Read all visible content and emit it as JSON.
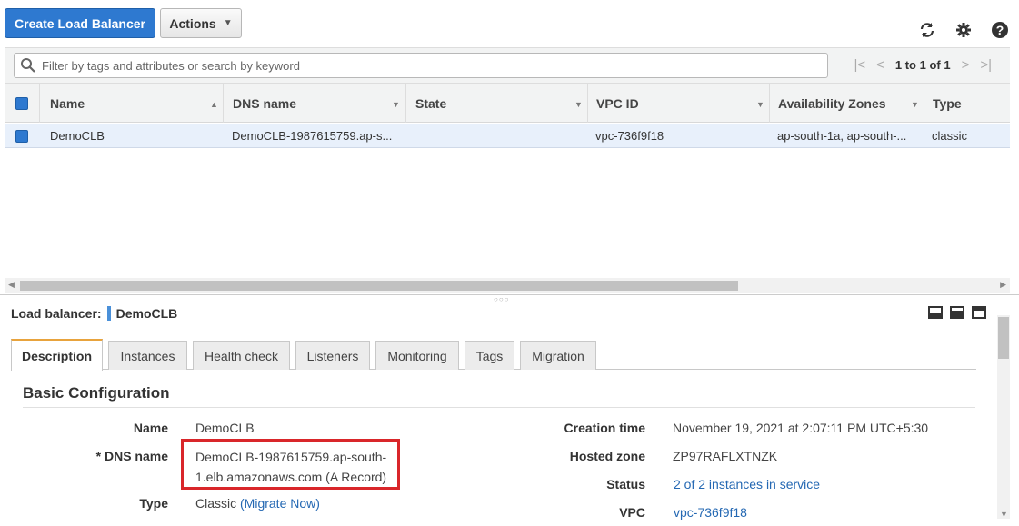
{
  "toolbar": {
    "create_label": "Create Load Balancer",
    "actions_label": "Actions"
  },
  "filter": {
    "placeholder": "Filter by tags and attributes or search by keyword",
    "page_info": "1 to 1 of 1"
  },
  "table": {
    "columns": [
      "Name",
      "DNS name",
      "State",
      "VPC ID",
      "Availability Zones",
      "Type"
    ],
    "rows": [
      {
        "name": "DemoCLB",
        "dns": "DemoCLB-1987615759.ap-s...",
        "state": "",
        "vpc": "vpc-736f9f18",
        "az": "ap-south-1a, ap-south-...",
        "type": "classic"
      }
    ]
  },
  "details": {
    "header_label": "Load balancer:",
    "header_name": "DemoCLB",
    "tabs": [
      "Description",
      "Instances",
      "Health check",
      "Listeners",
      "Monitoring",
      "Tags",
      "Migration"
    ],
    "section_title": "Basic Configuration",
    "left": {
      "name_label": "Name",
      "name_value": "DemoCLB",
      "dns_label": "* DNS name",
      "dns_value": "DemoCLB-1987615759.ap-south-1.elb.amazonaws.com (A Record)",
      "type_label": "Type",
      "type_value": "Classic",
      "migrate_link": "(Migrate Now)"
    },
    "right": {
      "creation_label": "Creation time",
      "creation_value": "November 19, 2021 at 2:07:11 PM UTC+5:30",
      "zone_label": "Hosted zone",
      "zone_value": "ZP97RAFLXTNZK",
      "status_label": "Status",
      "status_value": "2 of 2 instances in service",
      "vpc_label": "VPC",
      "vpc_value": "vpc-736f9f18"
    }
  },
  "colors": {
    "primary": "#2e79d0",
    "highlight_box": "#d9262a",
    "active_tab_accent": "#e8a33d",
    "link": "#2468b3"
  },
  "icons": [
    "refresh-icon",
    "gear-icon",
    "help-icon",
    "search-icon",
    "first-page-icon",
    "prev-page-icon",
    "next-page-icon",
    "last-page-icon"
  ]
}
